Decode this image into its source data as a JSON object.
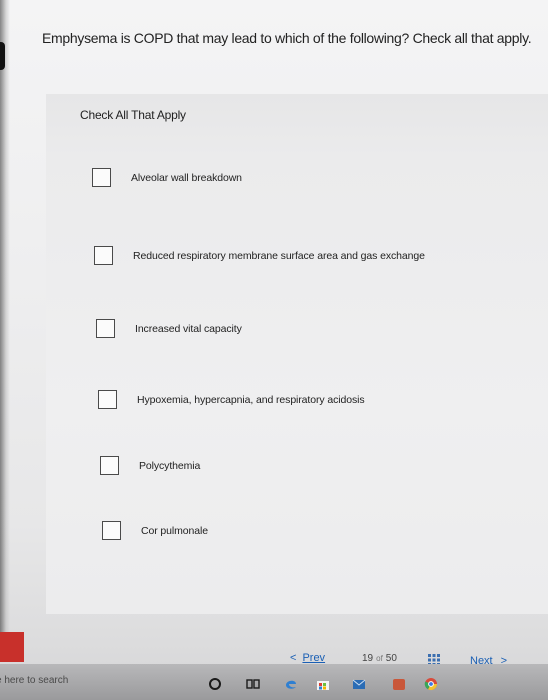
{
  "question": {
    "text": "Emphysema is COPD that may lead to which of the following? Check all that apply."
  },
  "panel": {
    "header": "Check All That Apply",
    "options": [
      {
        "label": "Alveolar wall breakdown",
        "checked": false
      },
      {
        "label": "Reduced respiratory membrane surface area and gas exchange",
        "checked": false
      },
      {
        "label": "Increased vital capacity",
        "checked": false
      },
      {
        "label": "Hypoxemia, hypercapnia, and respiratory acidosis",
        "checked": false
      },
      {
        "label": "Polycythemia",
        "checked": false
      },
      {
        "label": "Cor pulmonale",
        "checked": false
      }
    ]
  },
  "pager": {
    "prev_label": "Prev",
    "current": "19",
    "of_label": "of",
    "total": "50",
    "next_label": "Next",
    "prev_glyph": "<",
    "next_glyph": ">"
  },
  "taskbar": {
    "search_text": "e here to search",
    "icons": [
      "cortana-icon",
      "task-view-icon",
      "edge-icon",
      "store-icon",
      "mail-icon",
      "app-icon",
      "chrome-icon"
    ]
  },
  "colors": {
    "link": "#1a5fb4",
    "checkbox_border": "#4a4a4a",
    "red_tile": "#c8302b"
  }
}
